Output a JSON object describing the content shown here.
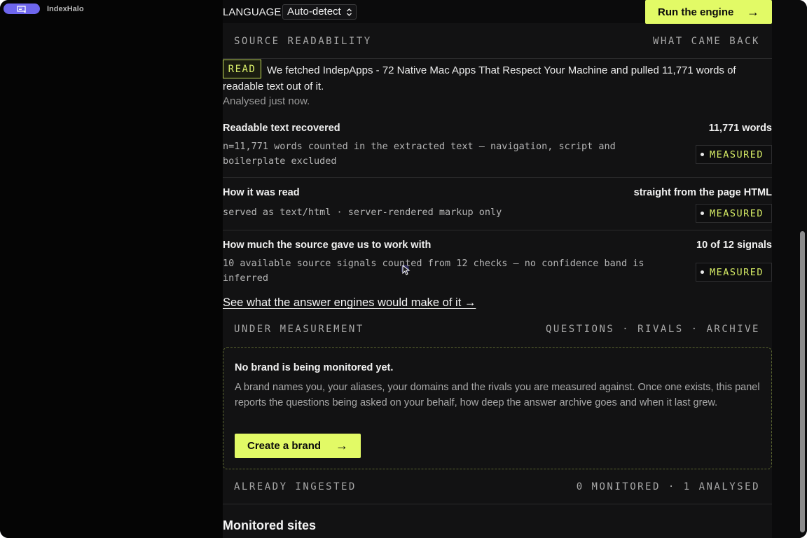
{
  "app": {
    "name": "IndexHalo",
    "icon": "monitor-icon"
  },
  "toolbar": {
    "language_label": "LANGUAGE",
    "language_value": "Auto-detect",
    "run_label": "Run the engine",
    "run_arrow": "→"
  },
  "readability": {
    "heading": "SOURCE READABILITY",
    "heading_right": "WHAT CAME BACK",
    "badge": "READ",
    "summary": "We fetched IndepApps - 72 Native Mac Apps That Respect Your Machine and pulled 11,771 words of readable text out of it.",
    "analysed": "Analysed just now.",
    "rows": [
      {
        "title": "Readable text recovered",
        "value": "11,771 words",
        "detail": "n=11,771 words counted in the extracted text — navigation, script and boilerplate excluded",
        "status": "MEASURED"
      },
      {
        "title": "How it was read",
        "value": "straight from the page HTML",
        "detail": "served as text/html · server-rendered markup only",
        "status": "MEASURED"
      },
      {
        "title": "How much the source gave us to work with",
        "value": "10 of 12 signals",
        "detail": "10 available source signals counted from 12 checks — no confidence band is inferred",
        "status": "MEASURED"
      }
    ],
    "link": "See what the answer engines would make of it →"
  },
  "measurement": {
    "heading": "UNDER MEASUREMENT",
    "heading_right": "QUESTIONS · RIVALS · ARCHIVE",
    "empty_title": "No brand is being monitored yet.",
    "empty_desc": "A brand names you, your aliases, your domains and the rivals you are measured against. Once one exists, this panel reports the questions being asked on your behalf, how deep the answer archive goes and when it last grew.",
    "create_label": "Create a brand",
    "create_arrow": "→"
  },
  "ingested": {
    "heading": "ALREADY INGESTED",
    "heading_right": "0 MONITORED · 1 ANALYSED"
  },
  "sites": {
    "title": "Monitored sites"
  },
  "colors": {
    "accent": "#e2fa66",
    "badge_border": "#c7e05a",
    "app_pill": "#6e66ee",
    "panel": "#121213"
  }
}
